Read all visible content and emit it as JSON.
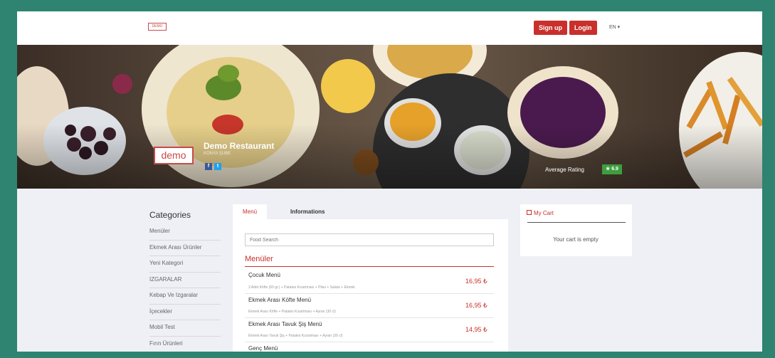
{
  "topbar": {
    "logo_text": "DEMO",
    "signup_label": "Sign up",
    "login_label": "Login",
    "language": "EN ▾"
  },
  "hero": {
    "logo_text": "demo",
    "restaurant_name": "Demo Restaurant",
    "branch": "KONYA ŞUBE",
    "average_rating_label": "Average Rating",
    "rating": "★ 6.9"
  },
  "categories": {
    "title": "Categories",
    "items": [
      "Menüler",
      "Ekmek Arası Ürünler",
      "Yeni Kategori",
      "IZGARALAR",
      "Kebap Ve Izgaralar",
      "İçecekler",
      "Mobil Test",
      "Fırın Ürünleri"
    ]
  },
  "menu": {
    "tabs": [
      "Menü",
      "Informations"
    ],
    "search_placeholder": "Food Search",
    "section_title": "Menüler",
    "items": [
      {
        "name": "Çocuk Menü",
        "desc": "3 Adet Köfte (60 gr.) + Patates Kızartması + Pilav + Salata + Ekmek",
        "price": "16,95 ₺"
      },
      {
        "name": "Ekmek Arası Köfte Menü",
        "desc": "Ekmek Arası Köfte + Patates Kızartması + Ayran (30 cl)",
        "price": "16,95 ₺"
      },
      {
        "name": "Ekmek Arası Tavuk Şiş Menü",
        "desc": "Ekmek Arası Tavuk Şiş + Patates Kızartması + Ayran (30 cl)",
        "price": "14,95 ₺"
      },
      {
        "name": "Genç Menü"
      }
    ]
  },
  "cart": {
    "title": "My Cart",
    "empty_text": "Your cart is empty"
  },
  "colors": {
    "accent": "#c9302c",
    "border": "#2e8470",
    "rating_green": "#3e9e3e"
  }
}
